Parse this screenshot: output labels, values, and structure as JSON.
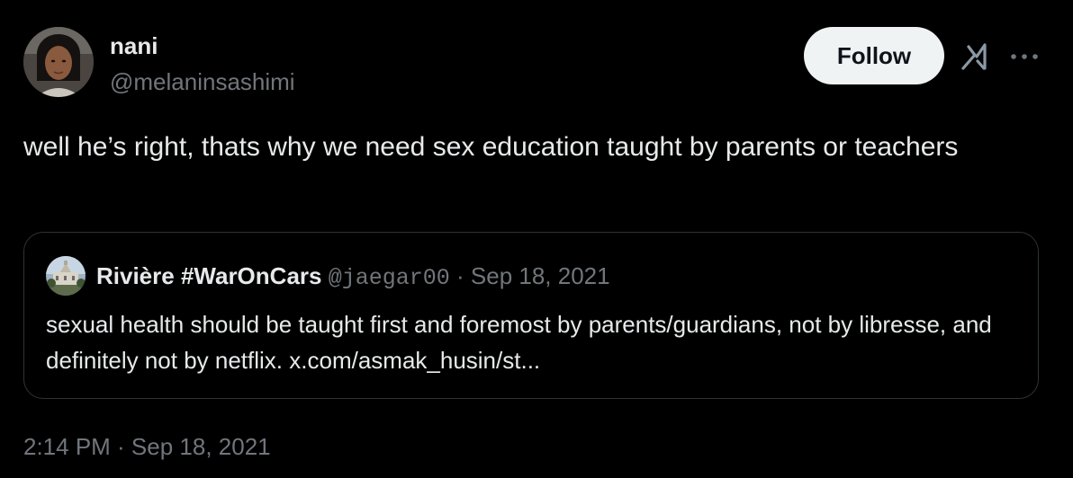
{
  "author": {
    "display_name": "nani",
    "handle": "@melaninsashimi",
    "avatar_icon": "user-avatar"
  },
  "actions": {
    "follow_label": "Follow",
    "grok_icon": "grok-icon",
    "more_icon": "more-dots-icon"
  },
  "tweet": {
    "text": "well he’s right, thats why we need sex education taught by parents or teachers",
    "timestamp": "2:14 PM · Sep 18, 2021"
  },
  "quote": {
    "display_name": "Rivière #WarOnCars",
    "handle": "@jaegar00",
    "separator": "·",
    "date": "Sep 18, 2021",
    "text": "sexual health should be taught first and foremost by parents/guardians, not by libresse, and definitely not by netflix. x.com/asmak_husin/st..."
  },
  "colors": {
    "background": "#000000",
    "primary_text": "#e7e9ea",
    "secondary_text": "#71767b",
    "border": "#2f3336",
    "follow_bg": "#eff3f4",
    "follow_text": "#0f1419"
  }
}
